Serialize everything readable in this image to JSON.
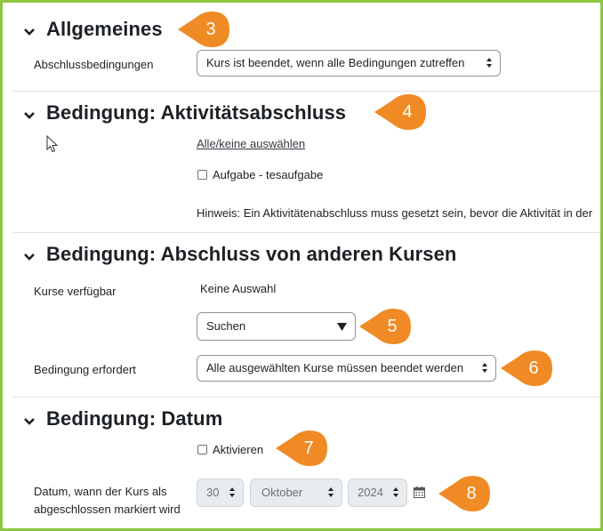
{
  "sections": {
    "general": {
      "title": "Allgemeines",
      "callout": "3"
    },
    "activity": {
      "title": "Bedingung: Aktivitätsabschluss",
      "callout": "4"
    },
    "courses": {
      "title": "Bedingung: Abschluss von anderen Kursen"
    },
    "date": {
      "title": "Bedingung: Datum"
    }
  },
  "general": {
    "completion_label": "Abschlussbedingungen",
    "completion_value": "Kurs ist beendet, wenn alle Bedingungen zutreffen"
  },
  "activity": {
    "select_all_link": "Alle/keine auswählen",
    "item_label": "Aufgabe - tesaufgabe",
    "hint": "Hinweis: Ein Aktivitätenabschluss muss gesetzt sein, bevor die Aktivität in der"
  },
  "courses": {
    "available_label": "Kurse verfügbar",
    "available_value": "Keine Auswahl",
    "search_placeholder": "Suchen",
    "search_callout": "5",
    "required_label": "Bedingung erfordert",
    "required_value": "Alle ausgewählten Kurse müssen beendet werden",
    "required_callout": "6"
  },
  "date": {
    "enable_label": "Aktivieren",
    "enable_callout": "7",
    "date_label_line1": "Datum, wann der Kurs als",
    "date_label_line2": "abgeschlossen markiert wird",
    "day": "30",
    "month": "Oktober",
    "year": "2024",
    "date_callout": "8"
  },
  "colors": {
    "callout": "#f08a24",
    "frame": "#8dc63f",
    "text": "#1d2125"
  }
}
